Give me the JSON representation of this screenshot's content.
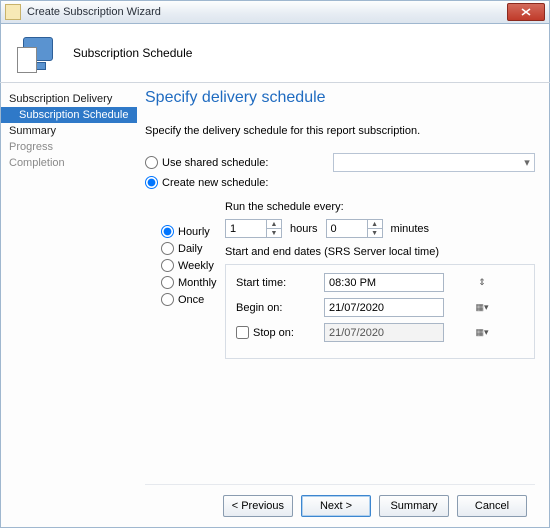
{
  "window": {
    "title": "Create Subscription Wizard"
  },
  "header": {
    "subtitle": "Subscription Schedule"
  },
  "nav": {
    "items": [
      {
        "label": "Subscription Delivery"
      },
      {
        "label": "Subscription Schedule"
      },
      {
        "label": "Summary"
      },
      {
        "label": "Progress"
      },
      {
        "label": "Completion"
      }
    ]
  },
  "main": {
    "heading": "Specify delivery schedule",
    "description": "Specify the delivery schedule for this report subscription.",
    "schedule_type": {
      "shared_label": "Use shared schedule:",
      "create_label": "Create new schedule:"
    },
    "frequency": {
      "run_every_label": "Run the schedule every:",
      "options": [
        "Hourly",
        "Daily",
        "Weekly",
        "Monthly",
        "Once"
      ],
      "hours_value": "1",
      "hours_label": "hours",
      "minutes_value": "0",
      "minutes_label": "minutes"
    },
    "dates": {
      "group_label": "Start and end dates (SRS Server local time)",
      "start_time_label": "Start time:",
      "start_time_value": "08:30 PM",
      "begin_on_label": "Begin on:",
      "begin_on_value": "21/07/2020",
      "stop_on_label": "Stop on:",
      "stop_on_value": "21/07/2020"
    }
  },
  "footer": {
    "previous": "< Previous",
    "next": "Next >",
    "summary": "Summary",
    "cancel": "Cancel"
  }
}
